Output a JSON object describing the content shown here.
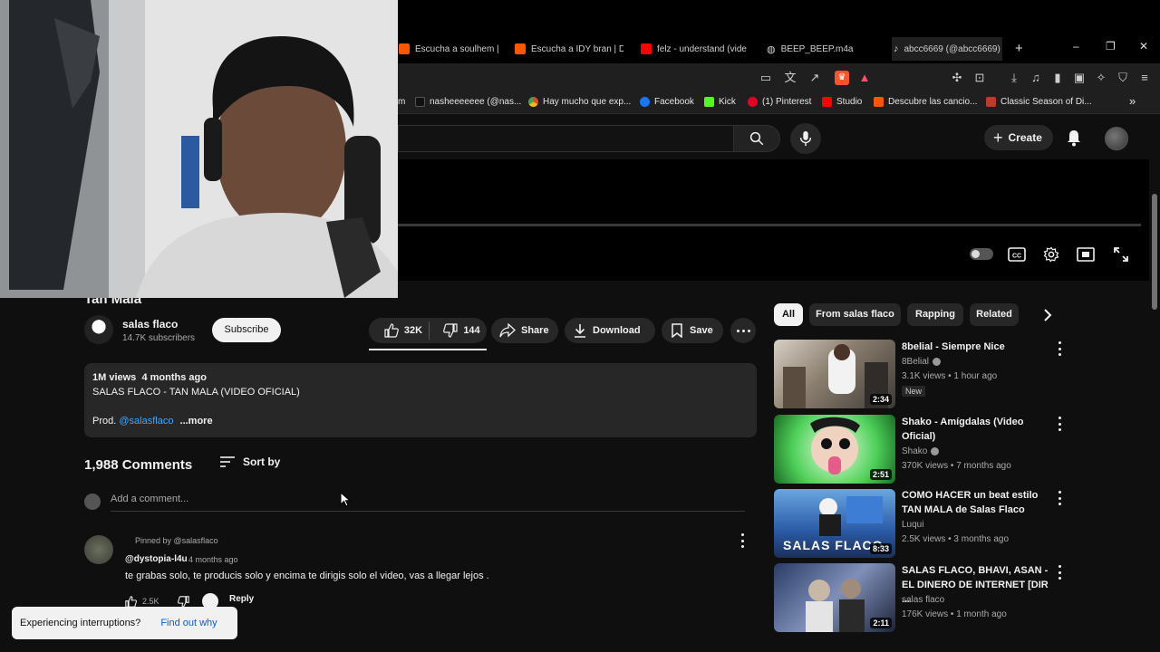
{
  "browser": {
    "tabs": [
      {
        "label": "Escucha a soulhem | D",
        "color": "#ff5500"
      },
      {
        "label": "Escucha a IDY bran | D",
        "color": "#ff5500"
      },
      {
        "label": "felz - understand (vide",
        "color": "#ff0000"
      },
      {
        "label": "BEEP_BEEP.m4a",
        "color": "#888888"
      },
      {
        "label": "abcc6669 (@abcc6669)",
        "color": "#000000"
      }
    ],
    "new_tab": "+",
    "window_controls": [
      "–",
      "❐",
      "✕"
    ],
    "bookmarks": [
      {
        "label": "nasheeeeeee (@nas...",
        "icon": "tiktok-icon"
      },
      {
        "label": "Hay mucho que exp...",
        "icon": "chrome-icon"
      },
      {
        "label": "Facebook",
        "icon": "facebook-icon"
      },
      {
        "label": "Kick",
        "icon": "kick-icon"
      },
      {
        "label": "(1) Pinterest",
        "icon": "pinterest-icon"
      },
      {
        "label": "Studio",
        "icon": "youtube-studio-icon"
      },
      {
        "label": "Descubre las cancio...",
        "icon": "soundcloud-icon"
      },
      {
        "label": "Classic Season of Di...",
        "icon": "link-icon"
      }
    ],
    "bookmarks_overflow": "»",
    "bookmark_prefix": "m"
  },
  "header": {
    "create_label": "Create"
  },
  "video": {
    "title": "Tan Mala",
    "channel": "salas flaco",
    "subscribers": "14.7K subscribers",
    "subscribe_label": "Subscribe",
    "likes": "32K",
    "dislikes": "144",
    "share_label": "Share",
    "download_label": "Download",
    "save_label": "Save"
  },
  "description": {
    "views": "1M views",
    "age": "4 months ago",
    "line1": "SALAS FLACO - TAN MALA (VIDEO OFICIAL)",
    "prod_label": "Prod.",
    "prod_link": "@salasflaco",
    "more_label": "...more"
  },
  "comments": {
    "count": "1,988 Comments",
    "sort_label": "Sort by",
    "add_placeholder": "Add a comment...",
    "pinned": {
      "pinned_by": "Pinned by @salasflaco",
      "author": "@dystopia-l4u",
      "time": "4 months ago",
      "text": "te grabas solo, te producis solo y encima te dirigis solo el video, vas a llegar lejos .",
      "likes": "2.5K",
      "reply_label": "Reply"
    }
  },
  "toast": {
    "message": "Experiencing interruptions?",
    "link": "Find out why"
  },
  "sidebar": {
    "chips": [
      "All",
      "From salas flaco",
      "Rapping",
      "Related"
    ],
    "videos": [
      {
        "title": "8belial - Siempre Nice",
        "channel": "8Belial",
        "verified": true,
        "meta": "3.1K views • 1 hour ago",
        "badge": "New",
        "duration": "2:34"
      },
      {
        "title": "Shako - Amígdalas (Video Oficial)",
        "channel": "Shako",
        "verified": true,
        "meta": "370K views • 7 months ago",
        "duration": "2:51"
      },
      {
        "title": "COMO HACER un beat estilo TAN MALA de Salas Flaco",
        "channel": "Luqui",
        "verified": false,
        "meta": "2.5K views • 3 months ago",
        "duration": "8:33",
        "thumb_text": "SALAS FLACO"
      },
      {
        "title": "SALAS FLACO, BHAVI, ASAN - EL DINERO DE INTERNET [DIR ...",
        "channel": "salas flaco",
        "verified": false,
        "meta": "176K views • 1 month ago",
        "duration": "2:11"
      }
    ]
  }
}
